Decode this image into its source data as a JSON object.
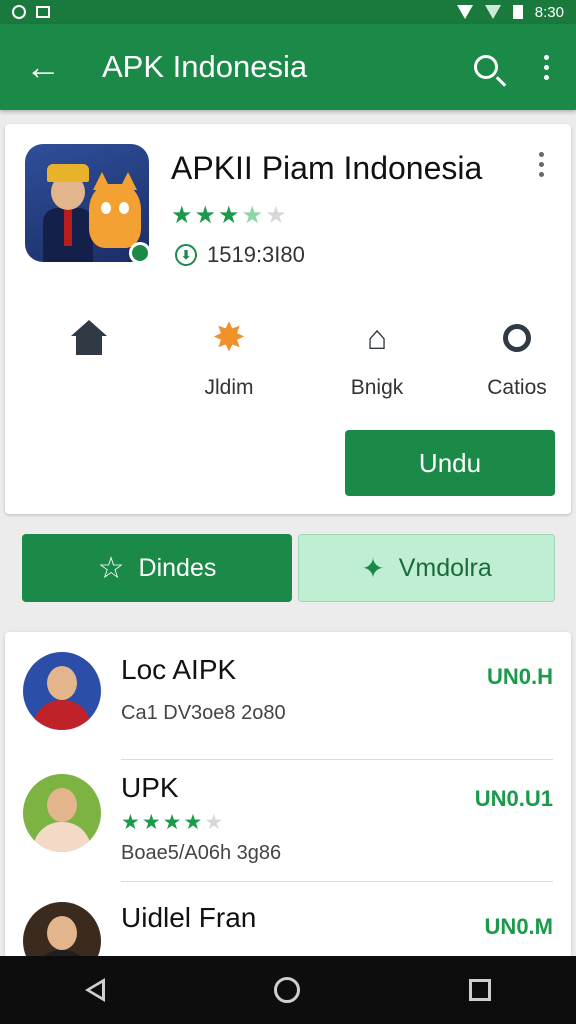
{
  "status_bar": {
    "time": "8:30"
  },
  "app_bar": {
    "title": "APK Indonesia",
    "back_icon": "arrow-left-icon",
    "search_icon": "search-icon",
    "more_icon": "more-vert-icon"
  },
  "app": {
    "name": "APKII Piam Indonesia",
    "rating": 3.5,
    "downloads": "1519:3I80",
    "accent": "#1b8a48"
  },
  "categories": [
    {
      "label": "",
      "icon": "home-icon"
    },
    {
      "label": "Jldim",
      "icon": "star-burst-icon"
    },
    {
      "label": "Bnigk",
      "icon": "graduation-cap-icon"
    },
    {
      "label": "Catios",
      "icon": "search-icon"
    }
  ],
  "primary_button": {
    "label": "Undu"
  },
  "tabs": [
    {
      "label": "Dindes",
      "icon": "star-outline-icon",
      "active": true
    },
    {
      "label": "Vmdolra",
      "icon": "sparkle-icon",
      "active": false
    }
  ],
  "list": [
    {
      "title": "Loc AIPK",
      "subtitle": "Ca1 DV3oe8 2o80",
      "action": "UN0.H",
      "rating": null
    },
    {
      "title": "UPK",
      "subtitle": "Boae5/A06h 3g86",
      "action": "UN0.U1",
      "rating": 4
    },
    {
      "title": "Uidlel Fran",
      "subtitle": "",
      "action": "UN0.M",
      "rating": null
    }
  ],
  "nav": {
    "back_icon": "nav-back-icon",
    "home_icon": "nav-home-icon",
    "recents_icon": "nav-recents-icon"
  }
}
